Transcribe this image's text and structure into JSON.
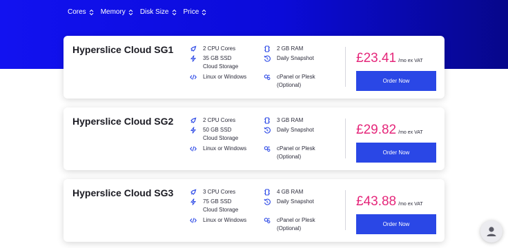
{
  "filters": [
    {
      "label": "Cores"
    },
    {
      "label": "Memory"
    },
    {
      "label": "Disk Size"
    },
    {
      "label": "Price"
    }
  ],
  "plans": [
    {
      "name": "Hyperslice Cloud SG1",
      "cores": "2 CPU Cores",
      "storage": "35 GB SSD Cloud Storage",
      "os": "Linux or Windows",
      "ram": "2 GB RAM",
      "snapshot": "Daily Snapshot",
      "panel": "cPanel or Plesk (Optional)",
      "price": "£23.41",
      "price_unit": "/mo ex VAT",
      "order_label": "Order Now"
    },
    {
      "name": "Hyperslice Cloud SG2",
      "cores": "2 CPU Cores",
      "storage": "50 GB SSD Cloud Storage",
      "os": "Linux or Windows",
      "ram": "3 GB RAM",
      "snapshot": "Daily Snapshot",
      "panel": "cPanel or Plesk (Optional)",
      "price": "£29.82",
      "price_unit": "/mo ex VAT",
      "order_label": "Order Now"
    },
    {
      "name": "Hyperslice Cloud SG3",
      "cores": "3 CPU Cores",
      "storage": "75 GB SSD Cloud Storage",
      "os": "Linux or Windows",
      "ram": "4 GB RAM",
      "snapshot": "Daily Snapshot",
      "panel": "cPanel or Plesk (Optional)",
      "price": "£43.88",
      "price_unit": "/mo ex VAT",
      "order_label": "Order Now"
    }
  ],
  "colors": {
    "hero_start": "#1212f0",
    "hero_end": "#07078a",
    "accent_icon": "#2a47e6",
    "price": "#e5267a",
    "button": "#2a47e6"
  },
  "icons": {
    "cores": "rocket-icon",
    "storage": "bolt-icon",
    "os": "code-icon",
    "ram": "memory-chip-icon",
    "snapshot": "history-icon",
    "panel": "gears-icon",
    "sort": "sort-icon",
    "support": "user-avatar-icon"
  }
}
